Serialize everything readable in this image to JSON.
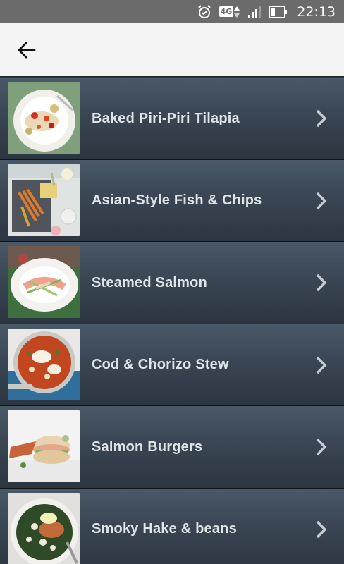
{
  "status_bar": {
    "network": "4G",
    "time": "22:13",
    "icons": [
      "alarm-icon",
      "network-arrows-icon",
      "signal-icon",
      "battery-icon"
    ]
  },
  "app_bar": {
    "back_icon": "arrow-left-icon"
  },
  "recipes": [
    {
      "title": "Baked Piri-Piri Tilapia",
      "chevron": "chevron-right-icon"
    },
    {
      "title": "Asian-Style Fish & Chips",
      "chevron": "chevron-right-icon"
    },
    {
      "title": "Steamed Salmon",
      "chevron": "chevron-right-icon"
    },
    {
      "title": "Cod & Chorizo Stew",
      "chevron": "chevron-right-icon"
    },
    {
      "title": "Salmon Burgers",
      "chevron": "chevron-right-icon"
    },
    {
      "title": "Smoky Hake & beans",
      "chevron": "chevron-right-icon"
    }
  ],
  "colors": {
    "status_bar": "#6b6b6b",
    "app_bar": "#f4f4f4",
    "row_top": "#4a5968",
    "row_bottom": "#2c3641",
    "title_text": "#dfe4e8"
  }
}
